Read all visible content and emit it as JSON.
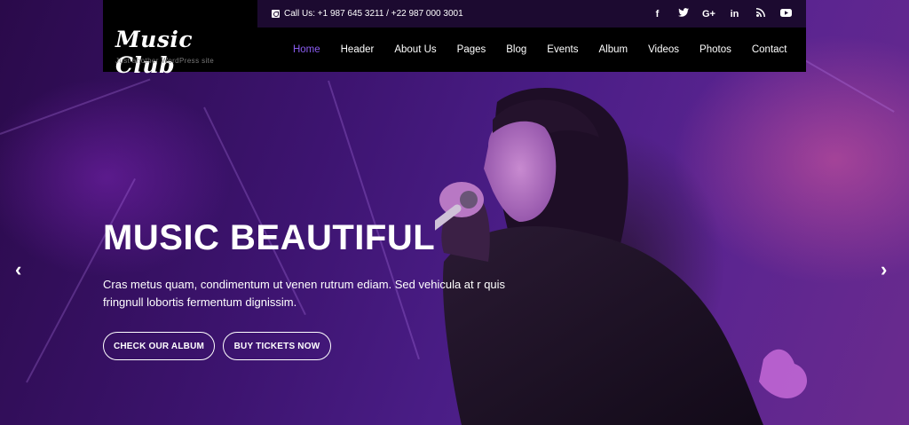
{
  "topbar": {
    "phone_text": "Call Us: +1 987 645 3211 / +22 987 000 3001",
    "social": [
      "f",
      "t",
      "G+",
      "in",
      "rss",
      "yt"
    ]
  },
  "brand": {
    "logo": "Music Club",
    "tagline": "Just another WordPress site"
  },
  "nav": {
    "items": [
      "Home",
      "Header",
      "About Us",
      "Pages",
      "Blog",
      "Events",
      "Album",
      "Videos",
      "Photos",
      "Contact"
    ],
    "active": "Home"
  },
  "hero": {
    "headline": "MUSIC BEAUTIFUL",
    "description": "Cras metus quam, condimentum ut venen rutrum ediam. Sed vehicula at r quis fringnull lobortis fermentum dignissim.",
    "btn_album": "CHECK OUR ALBUM",
    "btn_tickets": "BUY TICKETS NOW"
  },
  "slider": {
    "prev_icon": "‹",
    "next_icon": "›"
  },
  "colors": {
    "accent": "#8a5cf0",
    "header_bg": "#000000",
    "topbar_bg": "#1c0a30"
  }
}
